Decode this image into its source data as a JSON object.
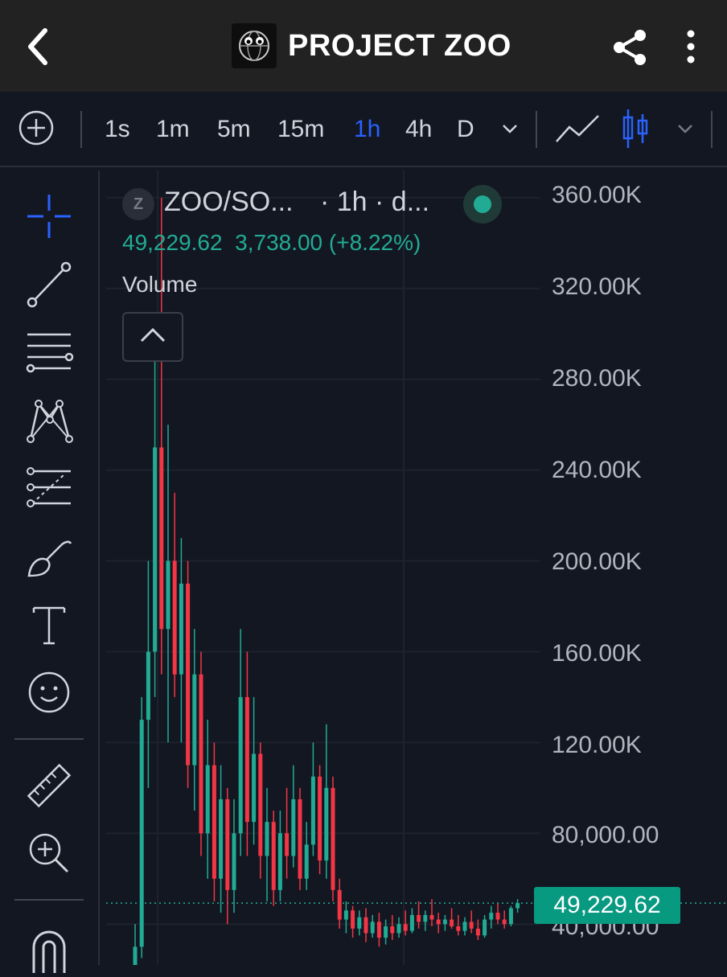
{
  "header": {
    "title": "PROJECT ZOO",
    "back_icon": "chevron-left-icon",
    "share_icon": "share-icon",
    "more_icon": "more-vertical-icon"
  },
  "toolbar": {
    "timeframes": [
      "1s",
      "1m",
      "5m",
      "15m",
      "1h",
      "4h",
      "D"
    ],
    "active_timeframe": "1h"
  },
  "legend": {
    "symbol_badge": "Z",
    "symbol": "ZOO/SO...",
    "interval": "· 1h · d...",
    "last_price": "49,229.62",
    "change": "3,738.00 (+8.22%)",
    "indicator": "Volume"
  },
  "price_axis": {
    "labels": [
      "360.00K",
      "320.00K",
      "280.00K",
      "240.00K",
      "200.00K",
      "160.00K",
      "120.00K",
      "80,000.00",
      "40,000.00"
    ],
    "current_price_label": "49,229.62"
  },
  "colors": {
    "up": "#22ab94",
    "down": "#f23645",
    "accent": "#2962ff",
    "background": "#131722",
    "header": "#222222"
  },
  "chart_data": {
    "type": "candlestick",
    "interval": "1h",
    "ylim": [
      22000,
      372000
    ],
    "current_price": 49229.62,
    "candles": [
      [
        14000,
        40000,
        8000,
        30000
      ],
      [
        30000,
        140000,
        25000,
        130000
      ],
      [
        130000,
        200000,
        100000,
        160000
      ],
      [
        160000,
        300000,
        140000,
        250000
      ],
      [
        250000,
        360000,
        150000,
        170000
      ],
      [
        170000,
        260000,
        120000,
        200000
      ],
      [
        200000,
        230000,
        140000,
        150000
      ],
      [
        150000,
        210000,
        120000,
        190000
      ],
      [
        190000,
        200000,
        100000,
        110000
      ],
      [
        110000,
        170000,
        90000,
        150000
      ],
      [
        150000,
        160000,
        70000,
        80000
      ],
      [
        80000,
        130000,
        60000,
        110000
      ],
      [
        110000,
        120000,
        50000,
        60000
      ],
      [
        60000,
        110000,
        45000,
        95000
      ],
      [
        95000,
        100000,
        40000,
        55000
      ],
      [
        55000,
        95000,
        45000,
        80000
      ],
      [
        80000,
        170000,
        70000,
        140000
      ],
      [
        140000,
        160000,
        70000,
        85000
      ],
      [
        85000,
        140000,
        75000,
        115000
      ],
      [
        115000,
        120000,
        60000,
        70000
      ],
      [
        70000,
        100000,
        50000,
        85000
      ],
      [
        85000,
        90000,
        48000,
        55000
      ],
      [
        55000,
        90000,
        50000,
        80000
      ],
      [
        80000,
        100000,
        60000,
        70000
      ],
      [
        70000,
        110000,
        65000,
        95000
      ],
      [
        95000,
        100000,
        55000,
        60000
      ],
      [
        60000,
        85000,
        55000,
        75000
      ],
      [
        75000,
        120000,
        70000,
        105000
      ],
      [
        105000,
        110000,
        62000,
        68000
      ],
      [
        68000,
        128000,
        60000,
        100000
      ],
      [
        100000,
        105000,
        50000,
        55000
      ],
      [
        55000,
        60000,
        38000,
        42000
      ],
      [
        42000,
        50000,
        36000,
        46000
      ],
      [
        46000,
        48000,
        34000,
        38000
      ],
      [
        38000,
        46000,
        35000,
        43000
      ],
      [
        43000,
        47000,
        32000,
        36000
      ],
      [
        36000,
        44000,
        34000,
        41000
      ],
      [
        41000,
        45000,
        30000,
        34000
      ],
      [
        34000,
        42000,
        31000,
        39000
      ],
      [
        39000,
        44000,
        33000,
        36000
      ],
      [
        36000,
        43000,
        34000,
        40000
      ],
      [
        40000,
        46000,
        35000,
        37000
      ],
      [
        37000,
        47000,
        36000,
        44000
      ],
      [
        44000,
        50000,
        38000,
        41000
      ],
      [
        41000,
        46000,
        37000,
        44000
      ],
      [
        44000,
        51000,
        39000,
        42000
      ],
      [
        42000,
        45000,
        36000,
        40000
      ],
      [
        40000,
        44000,
        37000,
        42000
      ],
      [
        42000,
        47000,
        38000,
        39000
      ],
      [
        39000,
        44000,
        35000,
        37000
      ],
      [
        37000,
        43000,
        35000,
        41000
      ],
      [
        41000,
        46000,
        36000,
        38000
      ],
      [
        38000,
        42000,
        33000,
        35000
      ],
      [
        35000,
        44000,
        34000,
        42000
      ],
      [
        42000,
        48000,
        38000,
        45000
      ],
      [
        45000,
        49000,
        40000,
        42000
      ],
      [
        42000,
        46000,
        38000,
        40000
      ],
      [
        40000,
        48000,
        39000,
        47000
      ],
      [
        47000,
        51000,
        45000,
        49230
      ]
    ]
  }
}
